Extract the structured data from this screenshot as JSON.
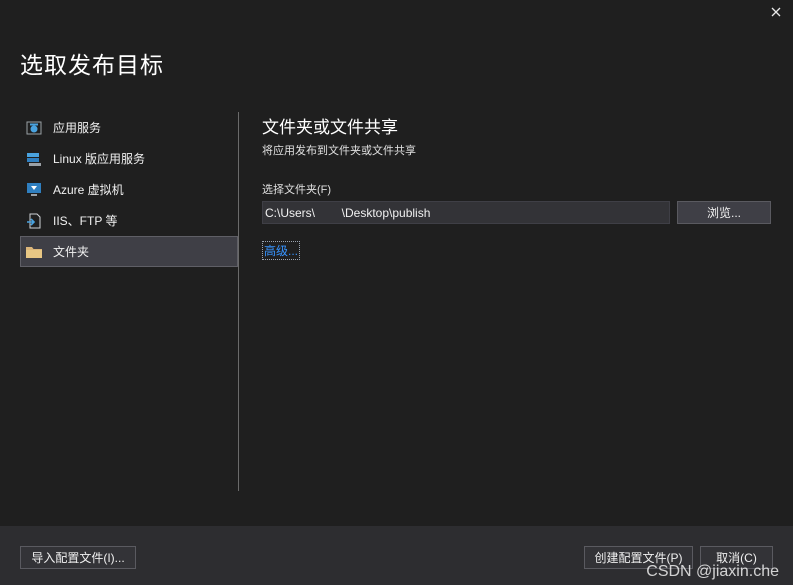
{
  "dialog": {
    "title": "选取发布目标",
    "close_icon": "close-icon"
  },
  "sidebar": {
    "items": [
      {
        "label": "应用服务",
        "icon": "app-service-icon",
        "selected": false
      },
      {
        "label": "Linux 版应用服务",
        "icon": "linux-app-service-icon",
        "selected": false
      },
      {
        "label": "Azure 虚拟机",
        "icon": "azure-vm-icon",
        "selected": false
      },
      {
        "label": "IIS、FTP 等",
        "icon": "iis-ftp-icon",
        "selected": false
      },
      {
        "label": "文件夹",
        "icon": "folder-icon",
        "selected": true
      }
    ]
  },
  "main": {
    "title": "文件夹或文件共享",
    "subtitle": "将应用发布到文件夹或文件共享",
    "folder_label": "选择文件夹(F)",
    "folder_value": "C:\\Users\\        \\Desktop\\publish",
    "browse_label": "浏览...",
    "advanced_label": "高级..."
  },
  "footer": {
    "import_label": "导入配置文件(I)...",
    "create_label": "创建配置文件(P)",
    "cancel_label": "取消(C)"
  },
  "watermark": "CSDN @jiaxin.che",
  "colors": {
    "background": "#1f1f1f",
    "footer": "#2d2d30",
    "selected": "#3f3f46",
    "link": "#3794ff"
  }
}
